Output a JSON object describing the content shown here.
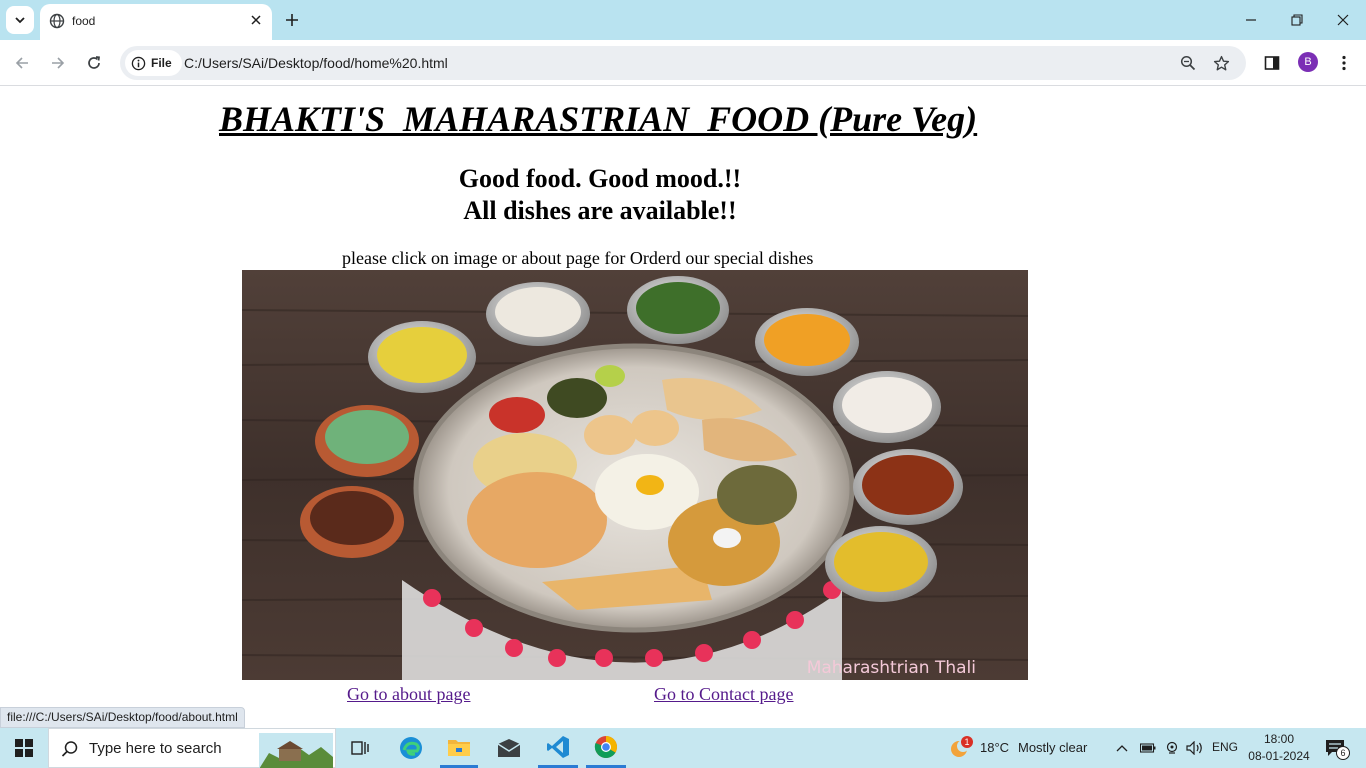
{
  "browser": {
    "tab": {
      "title": "food",
      "favicon": "globe-icon"
    },
    "url_chip": "File",
    "url": "C:/Users/SAi/Desktop/food/home%20.html",
    "profile_initial": "B",
    "status_url": "file:///C:/Users/SAi/Desktop/food/about.html"
  },
  "page": {
    "title": "BHAKTI'S  MAHARASTRIAN  FOOD (Pure Veg)",
    "tagline_1": "Good food. Good mood.!!",
    "tagline_2": "All dishes are available!!",
    "instructions": "please click on image or about page for Orderd our special dishes",
    "image_caption": "Maharashtrian Thali",
    "link_about": "Go to about page",
    "link_contact": "Go to Contact page"
  },
  "taskbar": {
    "search_placeholder": "Type here to search",
    "weather_badge": "1",
    "temperature": "18°C",
    "weather": "Mostly clear",
    "language": "ENG",
    "time": "18:00",
    "date": "08-01-2024",
    "notification_count": "6"
  },
  "colors": {
    "tabstrip": "#b9e3f0",
    "link_visited": "#551a8b",
    "taskbar": "#c6e7f0"
  }
}
